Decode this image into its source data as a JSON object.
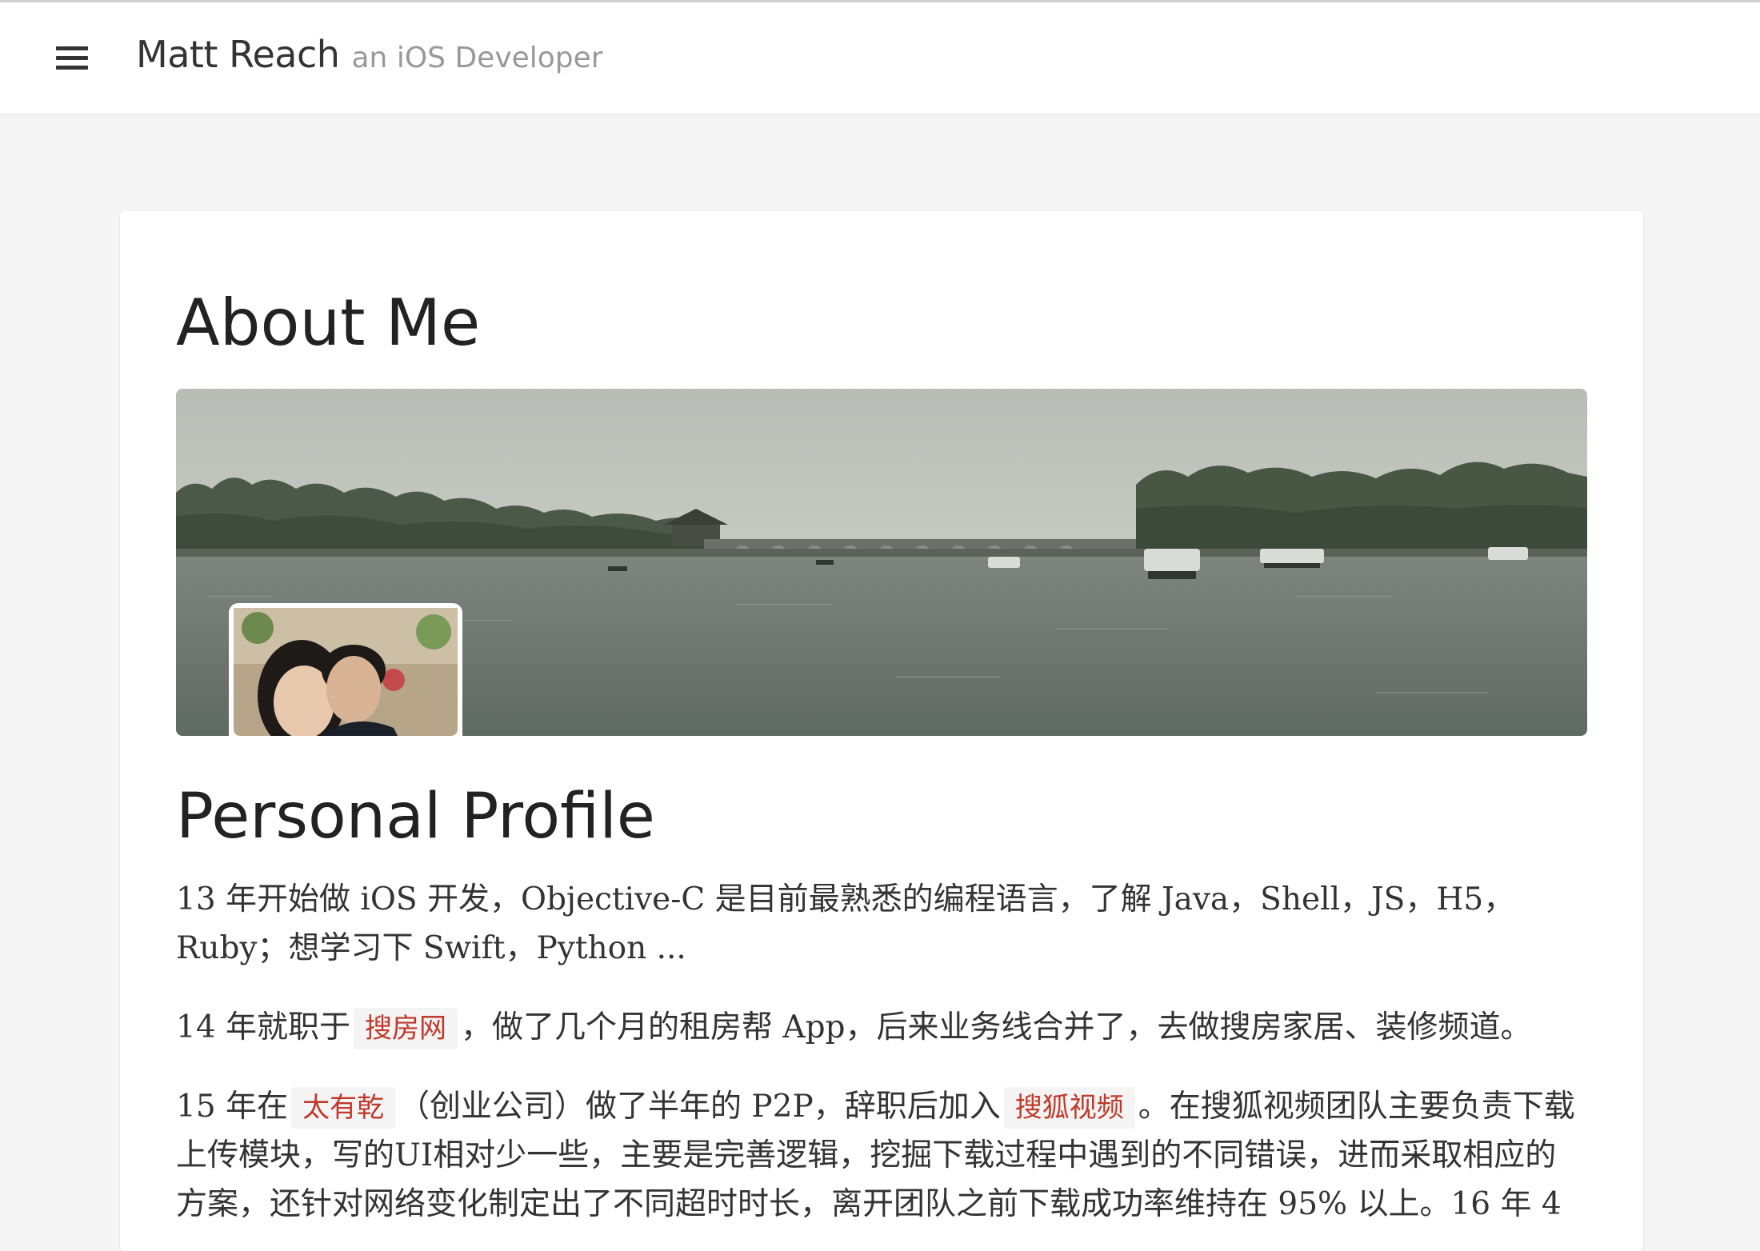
{
  "header": {
    "title": "Matt Reach",
    "subtitle": "an iOS Developer",
    "menu_icon": "hamburger-icon"
  },
  "page": {
    "title": "About Me",
    "banner_alt": "",
    "avatar_alt": ""
  },
  "profile": {
    "heading": "Personal Profile",
    "p1": "13 年开始做 iOS 开发，Objective-C 是目前最熟悉的编程语言，了解 Java，Shell，JS，H5，Ruby；想学习下 Swift，Python ...",
    "p2_before": "14 年就职于",
    "p2_link": "搜房网",
    "p2_after": "，做了几个月的租房帮 App，后来业务线合并了，去做搜房家居、装修频道。",
    "p3_before": "15 年在",
    "p3_link1": "太有乾",
    "p3_middle": "（创业公司）做了半年的 P2P，辞职后加入",
    "p3_link2": "搜狐视频",
    "p3_after": "。在搜狐视频团队主要负责下载上传模块，写的UI相对少一些，主要是完善逻辑，挖掘下载过程中遇到的不同错误，进而采取相应的方案，还针对网络变化制定出了不同超时时长，离开团队之前下载成功率维持在 95% 以上。16 年 4"
  },
  "colors": {
    "link": "#c0392b",
    "tag_bg": "#f4f4f4",
    "page_bg": "#f5f5f5"
  }
}
